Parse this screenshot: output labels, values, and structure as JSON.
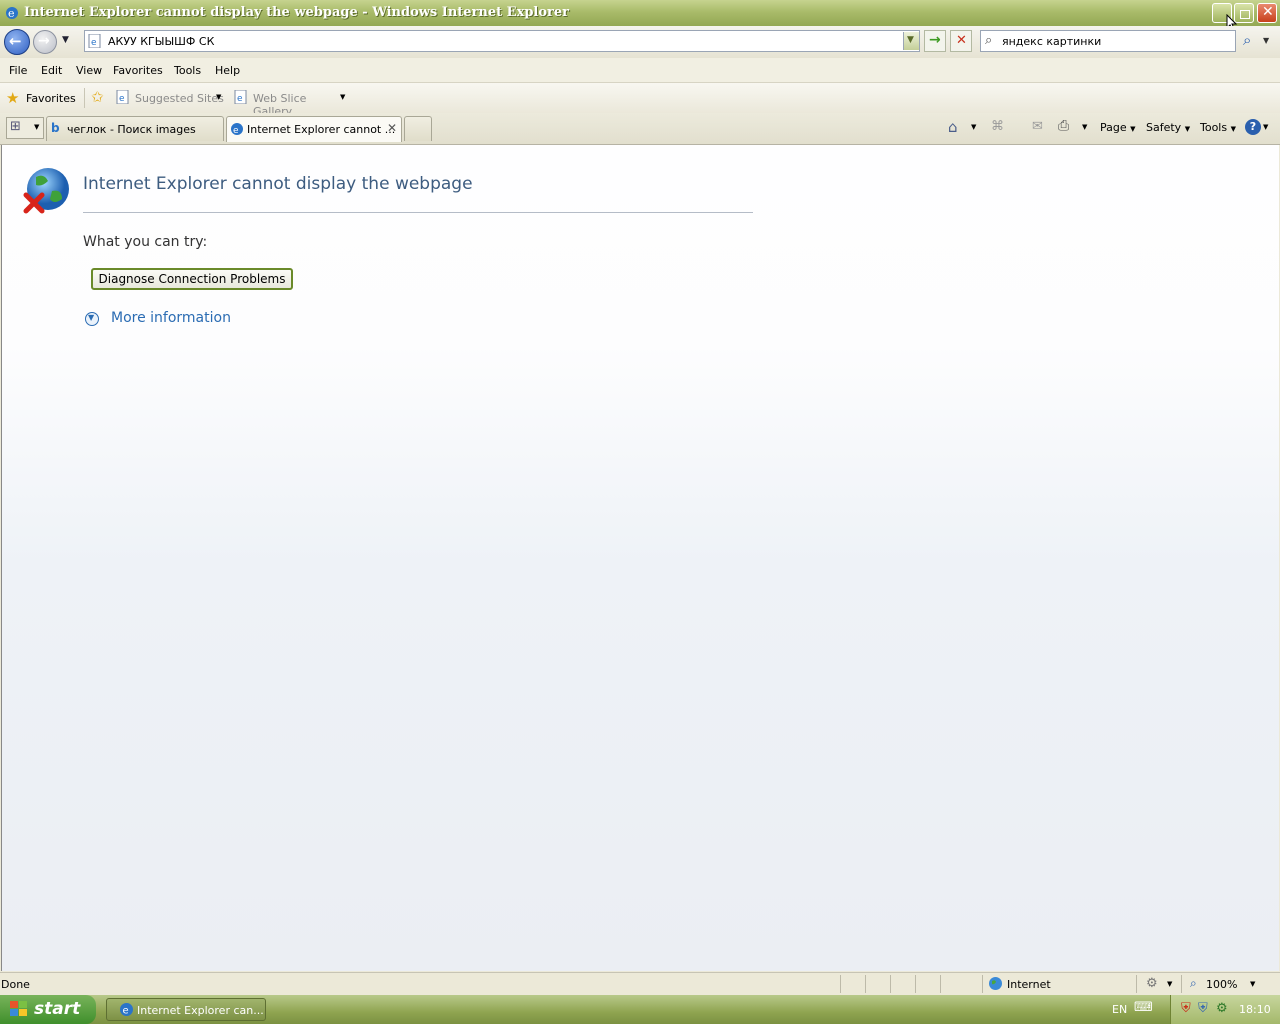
{
  "window": {
    "title": "Internet Explorer cannot display the webpage - Windows Internet Explorer"
  },
  "address": {
    "url": "АКУУ КГЫЫШФ СК"
  },
  "search": {
    "query": "яндекс картинки"
  },
  "menu": [
    "File",
    "Edit",
    "View",
    "Favorites",
    "Tools",
    "Help"
  ],
  "favorites_bar": {
    "favorites": "Favorites",
    "suggested": "Suggested Sites",
    "webslice": "Web Slice Gallery"
  },
  "tabs": [
    {
      "label": "чеглок - Поиск images",
      "active": false
    },
    {
      "label": "Internet Explorer cannot ...",
      "active": true
    }
  ],
  "command_bar": {
    "page": "Page",
    "safety": "Safety",
    "tools": "Tools"
  },
  "error_page": {
    "title": "Internet Explorer cannot display the webpage",
    "try_label": "What you can try:",
    "diagnose_button": "Diagnose Connection Problems",
    "more_info": "More information"
  },
  "status": {
    "text": "Done",
    "zone": "Internet",
    "zoom": "100%"
  },
  "taskbar": {
    "start": "start",
    "task": "Internet Explorer can...",
    "lang": "EN",
    "clock": "18:10"
  },
  "colors": {
    "title_bar": "#a9bb6a",
    "link": "#2b6cb3",
    "heading": "#3d5c80",
    "close_button": "#c8401c"
  }
}
